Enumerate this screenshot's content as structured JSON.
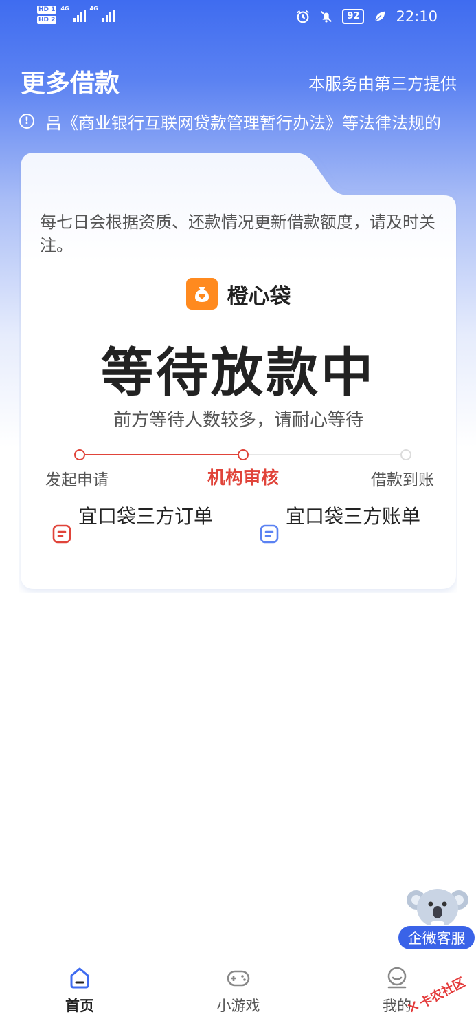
{
  "status_bar": {
    "sim1": "HD 1",
    "sim2": "HD 2",
    "net1": "4G",
    "net2": "4G",
    "battery": "92",
    "time": "22:10"
  },
  "header": {
    "title": "更多借款",
    "provider_note": "本服务由第三方提供",
    "notice": "吕《商业银行互联网贷款管理暂行办法》等法律法规的"
  },
  "card": {
    "description": "每七日会根据资质、还款情况更新借款额度，请及时关注。",
    "brand_name": "橙心袋",
    "status_title": "等待放款中",
    "status_sub": "前方等待人数较多，请耐心等待",
    "steps": [
      {
        "label": "发起申请",
        "state": "done"
      },
      {
        "label": "机构审核",
        "state": "active"
      },
      {
        "label": "借款到账",
        "state": "pending"
      }
    ],
    "links": {
      "orders": "宜口袋三方订单",
      "bills": "宜口袋三方账单"
    }
  },
  "service": {
    "label": "企微客服"
  },
  "bottom_nav": {
    "items": [
      {
        "label": "首页",
        "icon": "home-icon",
        "active": true
      },
      {
        "label": "小游戏",
        "icon": "gamepad-icon",
        "active": false
      },
      {
        "label": "我的",
        "icon": "profile-icon",
        "active": false
      }
    ]
  },
  "watermark": {
    "text": "卡农社区"
  },
  "colors": {
    "primary": "#3f6cf0",
    "accent_red": "#e0443a",
    "brand_orange": "#ff8a1f",
    "link_blue": "#5b82f2"
  }
}
